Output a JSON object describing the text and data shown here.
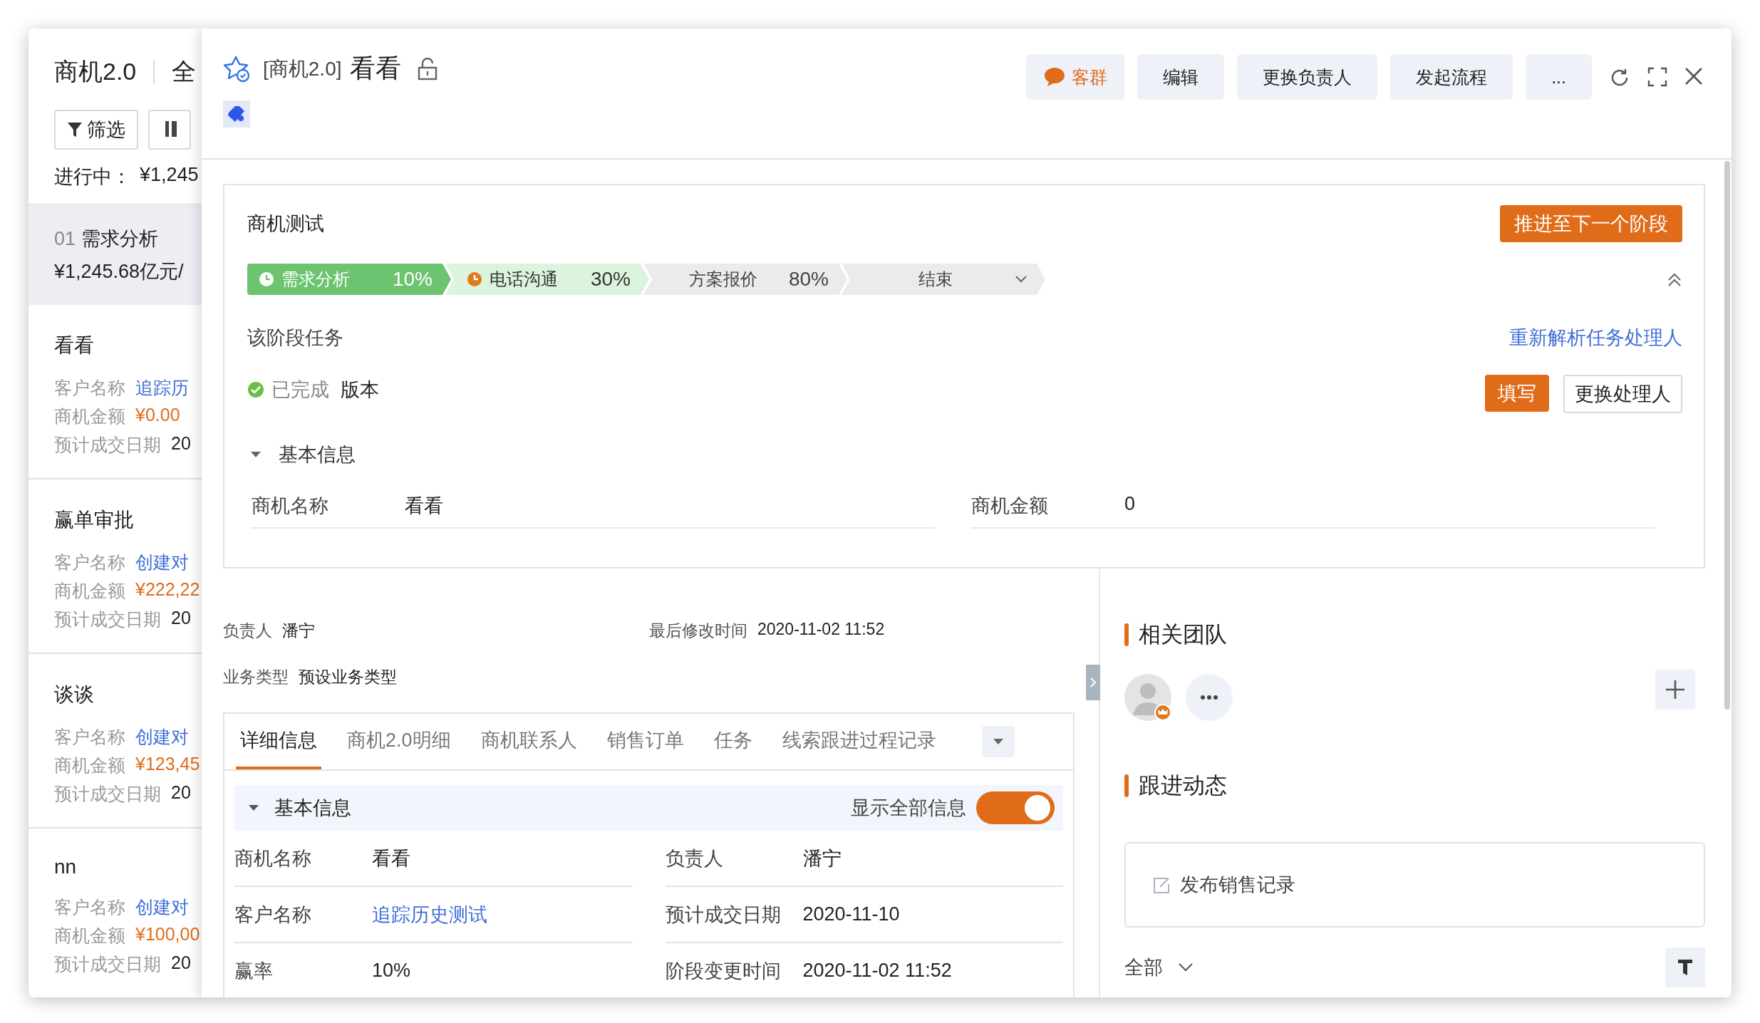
{
  "list_panel": {
    "title": "商机2.0",
    "view": "全",
    "filter_button": "筛选",
    "summary_label": "进行中：",
    "summary_value": "¥1,245",
    "stage": {
      "index": "01",
      "name": "需求分析",
      "amount": "¥1,245.68亿元/"
    },
    "cards": [
      {
        "title": "看看",
        "fields": [
          {
            "label": "客户名称",
            "value": "追踪历",
            "kind": "link"
          },
          {
            "label": "商机金额",
            "value": "¥0.00",
            "kind": "amount"
          },
          {
            "label": "预计成交日期",
            "value": "20",
            "kind": "text"
          }
        ]
      },
      {
        "title": "赢单审批",
        "fields": [
          {
            "label": "客户名称",
            "value": "创建对",
            "kind": "link"
          },
          {
            "label": "商机金额",
            "value": "¥222,22",
            "kind": "amount"
          },
          {
            "label": "预计成交日期",
            "value": "20",
            "kind": "text"
          }
        ]
      },
      {
        "title": "谈谈",
        "fields": [
          {
            "label": "客户名称",
            "value": "创建对",
            "kind": "link"
          },
          {
            "label": "商机金额",
            "value": "¥123,45",
            "kind": "amount"
          },
          {
            "label": "预计成交日期",
            "value": "20",
            "kind": "text"
          }
        ]
      },
      {
        "title": "nn",
        "fields": [
          {
            "label": "客户名称",
            "value": "创建对",
            "kind": "link"
          },
          {
            "label": "商机金额",
            "value": "¥100,00",
            "kind": "amount"
          },
          {
            "label": "预计成交日期",
            "value": "20",
            "kind": "text"
          }
        ]
      }
    ]
  },
  "header": {
    "prefix": "[商机2.0]",
    "title": "看看",
    "buttons": [
      {
        "label": "客群",
        "kind": "chat"
      },
      {
        "label": "编辑",
        "kind": "plain"
      },
      {
        "label": "更换负责人",
        "kind": "plain"
      },
      {
        "label": "发起流程",
        "kind": "plain"
      },
      {
        "label": "...",
        "kind": "plain"
      }
    ]
  },
  "stage_card": {
    "title": "商机测试",
    "advance_button": "推进至下一个阶段",
    "stages": [
      {
        "name": "需求分析",
        "percent": "10%",
        "done": true,
        "current": false
      },
      {
        "name": "电话沟通",
        "percent": "30%",
        "done": false,
        "current": true
      },
      {
        "name": "方案报价",
        "percent": "80%",
        "done": false,
        "current": false
      },
      {
        "name": "结束",
        "done": false,
        "current": false,
        "kind": "dropdown"
      }
    ],
    "tasks_heading": "该阶段任务",
    "reparse_link": "重新解析任务处理人",
    "tasks": [
      {
        "status_label": "已完成",
        "name": "版本",
        "done": true
      }
    ],
    "fill_button": "填写",
    "change_handler_button": "更换处理人",
    "section": {
      "title": "基本信息",
      "expanded": true,
      "fields": [
        {
          "label": "商机名称",
          "value": "看看"
        },
        {
          "label": "商机金额",
          "value": "0"
        }
      ]
    }
  },
  "summary": [
    {
      "label": "负责人",
      "value": "潘宁"
    },
    {
      "label": "最后修改时间",
      "value": "2020-11-02 11:52"
    },
    {
      "label": "业务类型",
      "value": "预设业务类型"
    }
  ],
  "tabs": [
    {
      "label": "详细信息",
      "selected": true
    },
    {
      "label": "商机2.0明细",
      "selected": false
    },
    {
      "label": "商机联系人",
      "selected": false
    },
    {
      "label": "销售订单",
      "selected": false
    },
    {
      "label": "任务",
      "selected": false
    },
    {
      "label": "线索跟进过程记录",
      "selected": false
    }
  ],
  "detail_section": {
    "title": "基本信息",
    "expanded": true,
    "toggle_label": "显示全部信息",
    "show_all": true,
    "fields": [
      {
        "label": "商机名称",
        "value": "看看",
        "kind": "text"
      },
      {
        "label": "负责人",
        "value": "潘宁",
        "kind": "text"
      },
      {
        "label": "客户名称",
        "value": "追踪历史测试",
        "kind": "link"
      },
      {
        "label": "预计成交日期",
        "value": "2020-11-10",
        "kind": "text"
      },
      {
        "label": "赢率",
        "value": "10%",
        "kind": "text"
      },
      {
        "label": "阶段变更时间",
        "value": "2020-11-02 11:52",
        "kind": "text"
      }
    ]
  },
  "team": {
    "title": "相关团队"
  },
  "follow_up": {
    "title": "跟进动态",
    "post_placeholder": "发布销售记录",
    "filter": "全部"
  }
}
